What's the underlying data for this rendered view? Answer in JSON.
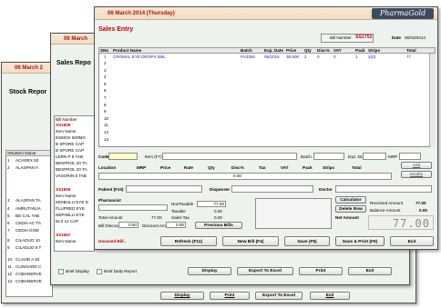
{
  "w1": {
    "title": "06 March 2",
    "heading": "Stock Repor",
    "col_sno": "SNo",
    "col_item": "Item Name",
    "rows": [
      {
        "sno": "1",
        "name": "ACAREX 50"
      },
      {
        "sno": "2",
        "name": "ALASPAN A"
      },
      {
        "sno": "3",
        "name": "ALASPAN TA"
      },
      {
        "sno": "4",
        "name": "AMRUTANJA"
      },
      {
        "sno": "5",
        "name": "BD CAL TAB"
      },
      {
        "sno": "6",
        "name": "CEDIA AC TA"
      },
      {
        "sno": "7",
        "name": "CEDIA GSM"
      },
      {
        "sno": "8",
        "name": "CILADUO 10"
      },
      {
        "sno": "9",
        "name": "CILADUO 5 T"
      },
      {
        "sno": "10",
        "name": "CLAVID A 62"
      },
      {
        "sno": "11",
        "name": "CLINGARD C"
      },
      {
        "sno": "12",
        "name": "COBANERVE"
      },
      {
        "sno": "13",
        "name": "COBANERVE"
      }
    ],
    "display": "Display",
    "print": "Print",
    "export": "Export To Excel",
    "exit": "Exit"
  },
  "w2": {
    "title": "06 March",
    "heading": "Sales Repo",
    "bill_number_label": "Bill Number",
    "list1": [
      "SS1605",
      "Item Name",
      "ESMOX 500MG",
      "B SPORE CAP",
      "B SPORE CAP",
      "LERN P 8 TAB",
      "BESPROL 20 TA",
      "BESPROL 20 TA",
      "VASORIN 5 TAB"
    ],
    "list2": [
      "SS1606",
      "Item Name",
      "MOIBULU EYE D",
      "FLUPRED EYE",
      "NEPABLU EYE",
      "ELII 12 CAP"
    ],
    "list3": [
      "SS1667",
      "Item Name"
    ],
    "brief_display": "Brief Display",
    "brief_daily": "Brief Daily Report",
    "display": "Display",
    "export": "Export To Excel",
    "print": "Print",
    "exit": "Exit"
  },
  "w3": {
    "date_title": "06 March 2014 (Thursday)",
    "logo": "PharmaGold",
    "heading": "Sales Entry",
    "bill_number_label": "Bill Number",
    "bill_number": "SS1752",
    "date_label": "Date",
    "date_value": "06/03/2014",
    "cols": [
      "SNo",
      "Product Name",
      "Batch",
      "Exp. Date",
      "Price",
      "Qty",
      "Disc%",
      "VAT",
      "Pack",
      "Strips",
      "Total"
    ],
    "row1": {
      "sno": "1",
      "name": "CROMAL EYE DROPS 5ML",
      "batch": "FA3354",
      "exp": "05/2016",
      "price": "38.500",
      "qty": "2",
      "disc": "0",
      "vat": "0",
      "pack": "1",
      "strips": "2(0)",
      "total": "77"
    },
    "row_numbers": [
      "2",
      "3",
      "4",
      "5",
      "6",
      "7",
      "8",
      "9",
      "10",
      "11",
      "12",
      "13"
    ],
    "code_label": "Code",
    "item_label": "Item (F7)",
    "batch_label": "Batch",
    "expdt_label": "Exp. Dt.",
    "mrp_label": "MRP",
    "add": "Add",
    "modify": "Modify",
    "loc_cols": [
      "Location",
      "MRP",
      "Price",
      "Rate",
      "Qty",
      "Disc%",
      "Tax",
      "VAT",
      "Pack",
      "Strips",
      "Total"
    ],
    "disc_value": "0.00",
    "patient_label": "Patient (F10)",
    "dispenser_label": "Dispenser",
    "doctor_label": "Doctor",
    "pharmacist_label": "Pharmacist",
    "nontaxable_label": "NonTaxable",
    "nontaxable": "77.00",
    "taxable_label": "Taxable",
    "taxable": "0.00",
    "salestax_label": "Sales Tax",
    "salestax": "0.00",
    "total_label": "Total Amount",
    "total": "77.00",
    "billdiscount_label": "Bill Discount",
    "billdiscount": "0.00",
    "discountamt_label": "Discount Amt",
    "discountamt": "0.00",
    "previous_bills": "Previous Bills",
    "calculator": "Calculator",
    "delete_row": "Delete Row",
    "net_amount_label": "Net Amount",
    "received_label": "Received Amount",
    "received": "77.00",
    "balance_label": "Balance Amount",
    "balance": "0.00",
    "big_amount": "77.00",
    "unsaved": "Unsaved Bill..",
    "refresh": "Refresh (F11)",
    "newbill": "New Bill (F4)",
    "save": "Save (F5)",
    "saveprint": "Save & Print (F9)",
    "exit": "Exit"
  }
}
